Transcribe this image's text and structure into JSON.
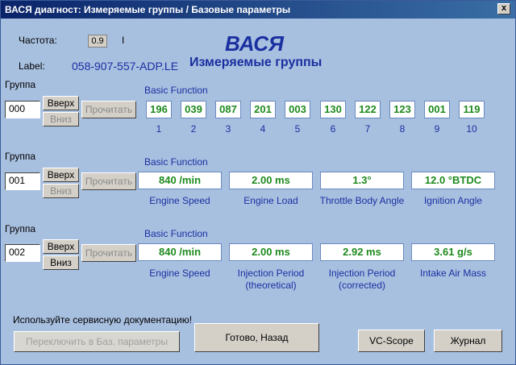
{
  "window": {
    "title": "ВАСЯ диагност: Измеряемые группы / Базовые параметры",
    "close_glyph": "x"
  },
  "header": {
    "freq_label": "Частота:",
    "freq_value": "0.9",
    "freq_unit": "I",
    "label_label": "Label:",
    "label_value": "058-907-557-ADP.LE",
    "app_name": "ВАСЯ",
    "subtitle": "Измеряемые группы"
  },
  "groups": [
    {
      "label": "Группа",
      "number": "000",
      "up": "Вверх",
      "down": "Вниз",
      "read": "Прочитать",
      "mode": "Basic Function",
      "values": [
        "196",
        "039",
        "087",
        "201",
        "003",
        "130",
        "122",
        "123",
        "001",
        "119"
      ],
      "indices": [
        "1",
        "2",
        "3",
        "4",
        "5",
        "6",
        "7",
        "8",
        "9",
        "10"
      ]
    },
    {
      "label": "Группа",
      "number": "001",
      "up": "Вверх",
      "down": "Вниз",
      "read": "Прочитать",
      "mode": "Basic Function",
      "values": [
        "840 /min",
        "2.00 ms",
        "1.3°",
        "12.0 °BTDC"
      ],
      "descriptions": [
        [
          "Engine Speed"
        ],
        [
          "Engine Load"
        ],
        [
          "Throttle Body Angle"
        ],
        [
          "Ignition Angle"
        ]
      ]
    },
    {
      "label": "Группа",
      "number": "002",
      "up": "Вверх",
      "down": "Вниз",
      "read": "Прочитать",
      "mode": "Basic Function",
      "values": [
        "840 /min",
        "2.00 ms",
        "2.92 ms",
        "3.61 g/s"
      ],
      "descriptions": [
        [
          "Engine Speed"
        ],
        [
          "Injection Period",
          "(theoretical)"
        ],
        [
          "Injection Period",
          "(corrected)"
        ],
        [
          "Intake Air Mass"
        ]
      ]
    }
  ],
  "footer": {
    "note": "Используйте сервисную документацию!",
    "switch_btn": "Переключить в Баз. параметры",
    "done_btn": "Готово, Назад",
    "vcscope_btn": "VC-Scope",
    "log_btn": "Журнал"
  }
}
